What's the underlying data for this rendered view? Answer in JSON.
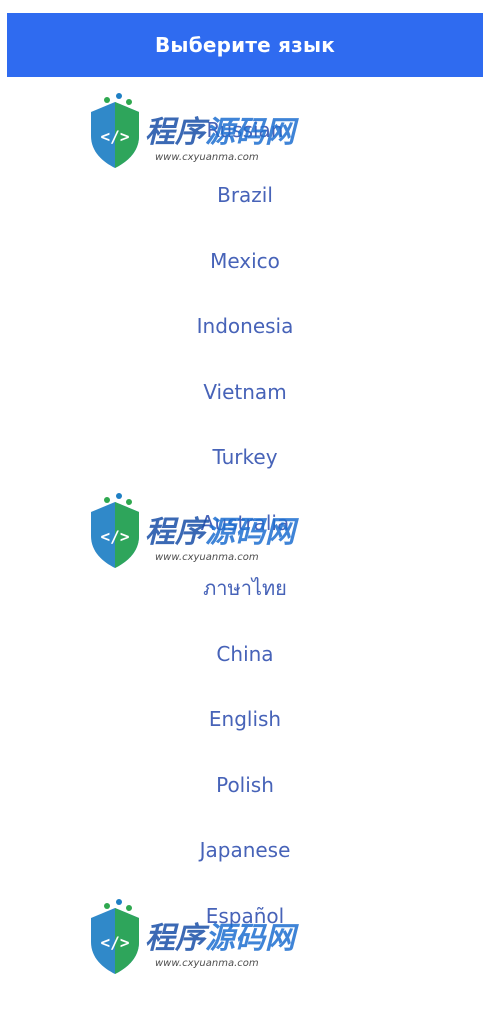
{
  "header": {
    "title": "Выберите язык",
    "color": "#2f6bf0"
  },
  "languages": [
    {
      "label": "Russian"
    },
    {
      "label": "Brazil"
    },
    {
      "label": "Mexico"
    },
    {
      "label": "Indonesia"
    },
    {
      "label": "Vietnam"
    },
    {
      "label": "Turkey"
    },
    {
      "label": "Australia"
    },
    {
      "label": "ภาษาไทย"
    },
    {
      "label": "China"
    },
    {
      "label": "English"
    },
    {
      "label": "Polish"
    },
    {
      "label": "Japanese"
    },
    {
      "label": "Español"
    }
  ],
  "watermark": {
    "chinese": "程序源码网",
    "url": "www.cxyuanma.com"
  },
  "colors": {
    "item_text": "#4763b8",
    "background": "#ffffff"
  }
}
